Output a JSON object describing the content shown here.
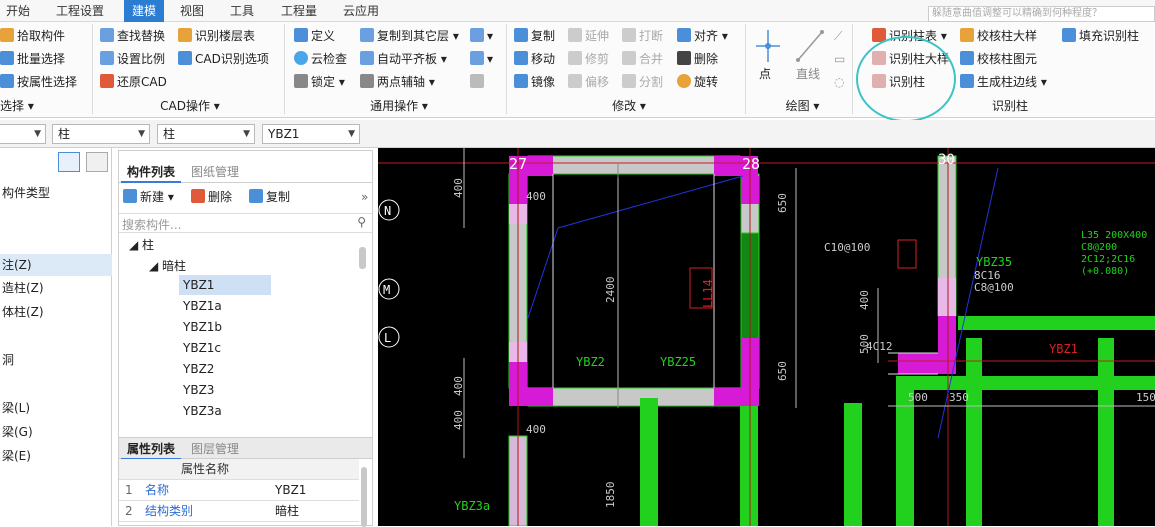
{
  "menubar": {
    "items": [
      "开始",
      "工程设置",
      "建模",
      "视图",
      "工具",
      "工程量",
      "云应用"
    ],
    "active_index": 2,
    "search_placeholder": "躲随意曲值调整可以精确到何种程度？"
  },
  "ribbon": {
    "select": {
      "b1": "拾取构件",
      "b2": "批量选择",
      "b3": "按属性选择",
      "group": "选择 ▾"
    },
    "cad": {
      "b1": "查找替换",
      "b2": "设置比例",
      "b3": "还原CAD",
      "b4": "识别楼层表",
      "b5": "CAD识别选项",
      "group": "CAD操作 ▾"
    },
    "common": {
      "b1": "定义",
      "b2": "云检查",
      "b3": "锁定 ▾",
      "b4": "复制到其它层 ▾",
      "b5": "自动平齐板 ▾",
      "b6": "两点辅轴 ▾",
      "group": "通用操作 ▾"
    },
    "modify": {
      "b1": "复制",
      "b2": "移动",
      "b3": "镜像",
      "b4": "延伸",
      "b5": "修剪",
      "b6": "偏移",
      "b7": "打断",
      "b8": "合并",
      "b9": "分割",
      "b10": "对齐 ▾",
      "b11": "删除",
      "b12": "旋转",
      "group": "修改 ▾"
    },
    "draw": {
      "b1": "点",
      "b2": "直线",
      "group": "绘图 ▾"
    },
    "recog": {
      "b1": "识别柱表 ▾",
      "b2": "识别柱大样",
      "b3": "识别柱",
      "b4": "校核柱大样",
      "b5": "校核柱图元",
      "b6": "生成柱边线 ▾",
      "b7": "填充识别柱",
      "group": "识别柱"
    }
  },
  "toolbar2": {
    "s1": "",
    "s2": "柱",
    "s3": "柱",
    "s4": "YBZ1"
  },
  "leftpane": {
    "items": [
      "构件类型",
      "注(Z)",
      "造柱(Z)",
      "体柱(Z)",
      "洞",
      "梁(L)",
      "梁(G)",
      "梁(E)"
    ],
    "selected_index": 1
  },
  "component_list": {
    "tab_active": "构件列表",
    "tab_other": "图纸管理",
    "new_label": "新建 ▾",
    "delete_label": "删除",
    "copy_label": "复制",
    "search_placeholder": "搜索构件...",
    "tree_root": "柱",
    "tree_sub": "暗柱",
    "items": [
      "YBZ1",
      "YBZ1a",
      "YBZ1b",
      "YBZ1c",
      "YBZ2",
      "YBZ3",
      "YBZ3a"
    ],
    "selected_item": "YBZ1"
  },
  "props": {
    "tab_active": "属性列表",
    "tab_other": "图层管理",
    "col_header": "属性名称",
    "rows": [
      {
        "idx": "1",
        "name": "名称",
        "value": "YBZ1"
      },
      {
        "idx": "2",
        "name": "结构类别",
        "value": "暗柱"
      }
    ]
  },
  "canvas": {
    "axes": [
      "N",
      "M",
      "L"
    ],
    "col_numbers": [
      "27",
      "28",
      "30"
    ],
    "labels": {
      "ybz2": "YBZ2",
      "ybz25": "YBZ25",
      "ybz35": "YBZ35",
      "ybz1": "YBZ1",
      "ybz3a": "YBZ3a",
      "ll14": "LL14",
      "c10": "C10@100",
      "c4": "4C12",
      "c8": "8C16",
      "c8b": "C8@100",
      "l35": "L35 200X400",
      "l35b": "C8@200",
      "l35c": "2C12;2C16",
      "l35d": "(+0.080)"
    },
    "dims": {
      "d400a": "400",
      "d400b": "400",
      "d400c": "400",
      "d400d": "400",
      "d400e": "400",
      "d2400": "2400",
      "d650a": "650",
      "d650b": "650",
      "d500a": "500",
      "d500b": "500",
      "d350": "350",
      "d1850": "1850",
      "d150": "150",
      "d400f": "400"
    }
  },
  "colors": {
    "accent": "#2b7cd3",
    "highlight": "#3cc3c5",
    "column": "#d61ad6",
    "beam": "#22d11e",
    "wall": "#c8c8c8"
  }
}
